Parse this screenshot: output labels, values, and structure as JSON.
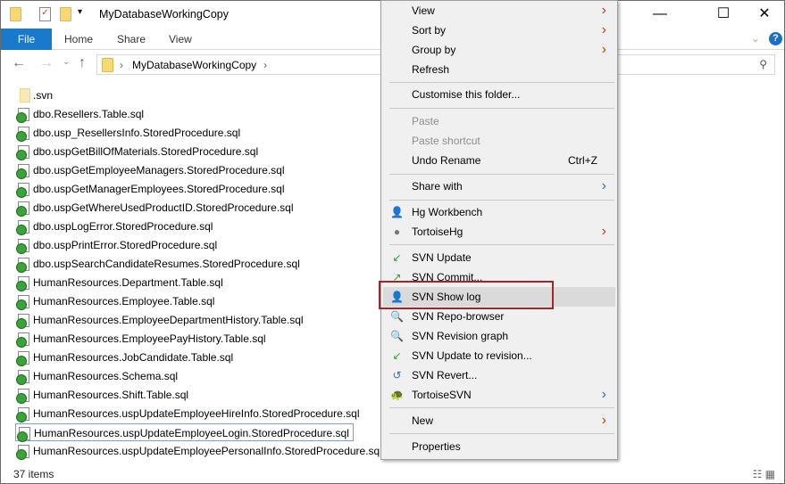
{
  "window": {
    "title": "MyDatabaseWoringCopy_placeholder"
  },
  "title": "MyDatabaseWorkingCopy",
  "ribbon": {
    "tabs": [
      "File",
      "Home",
      "Share",
      "View"
    ]
  },
  "address": {
    "crumb": "MyDatabaseWorkingCopy"
  },
  "files": [
    ".svn",
    "dbo.Resellers.Table.sql",
    "dbo.usp_ResellersInfo.StoredProcedure.sql",
    "dbo.uspGetBillOfMaterials.StoredProcedure.sql",
    "dbo.uspGetEmployeeManagers.StoredProcedure.sql",
    "dbo.uspGetManagerEmployees.StoredProcedure.sql",
    "dbo.uspGetWhereUsedProductID.StoredProcedure.sql",
    "dbo.uspLogError.StoredProcedure.sql",
    "dbo.uspPrintError.StoredProcedure.sql",
    "dbo.uspSearchCandidateResumes.StoredProcedure.sql",
    "HumanResources.Department.Table.sql",
    "HumanResources.Employee.Table.sql",
    "HumanResources.EmployeeDepartmentHistory.Table.sql",
    "HumanResources.EmployeePayHistory.Table.sql",
    "HumanResources.JobCandidate.Table.sql",
    "HumanResources.Schema.sql",
    "HumanResources.Shift.Table.sql",
    "HumanResources.uspUpdateEmployeeHireInfo.StoredProcedure.sql",
    "HumanResources.uspUpdateEmployeeLogin.StoredProcedure.sql",
    "HumanResources.uspUpdateEmployeePersonalInfo.StoredProcedure.sql"
  ],
  "status": "37 items",
  "menu": {
    "view": "View",
    "sort_by": "Sort by",
    "group_by": "Group by",
    "refresh": "Refresh",
    "customise": "Customise this folder...",
    "paste": "Paste",
    "paste_shortcut": "Paste shortcut",
    "undo_rename": "Undo Rename",
    "undo_shortcut": "Ctrl+Z",
    "share_with": "Share with",
    "hg_workbench": "Hg Workbench",
    "tortoisehg": "TortoiseHg",
    "svn_update": "SVN Update",
    "svn_commit": "SVN Commit...",
    "svn_show_log": "SVN Show log",
    "svn_repo_browser": "SVN Repo-browser",
    "svn_revision_graph": "SVN Revision graph",
    "svn_update_to_revision": "SVN Update to revision...",
    "svn_revert": "SVN Revert...",
    "tortoisesvn": "TortoiseSVN",
    "new": "New",
    "properties": "Properties"
  }
}
